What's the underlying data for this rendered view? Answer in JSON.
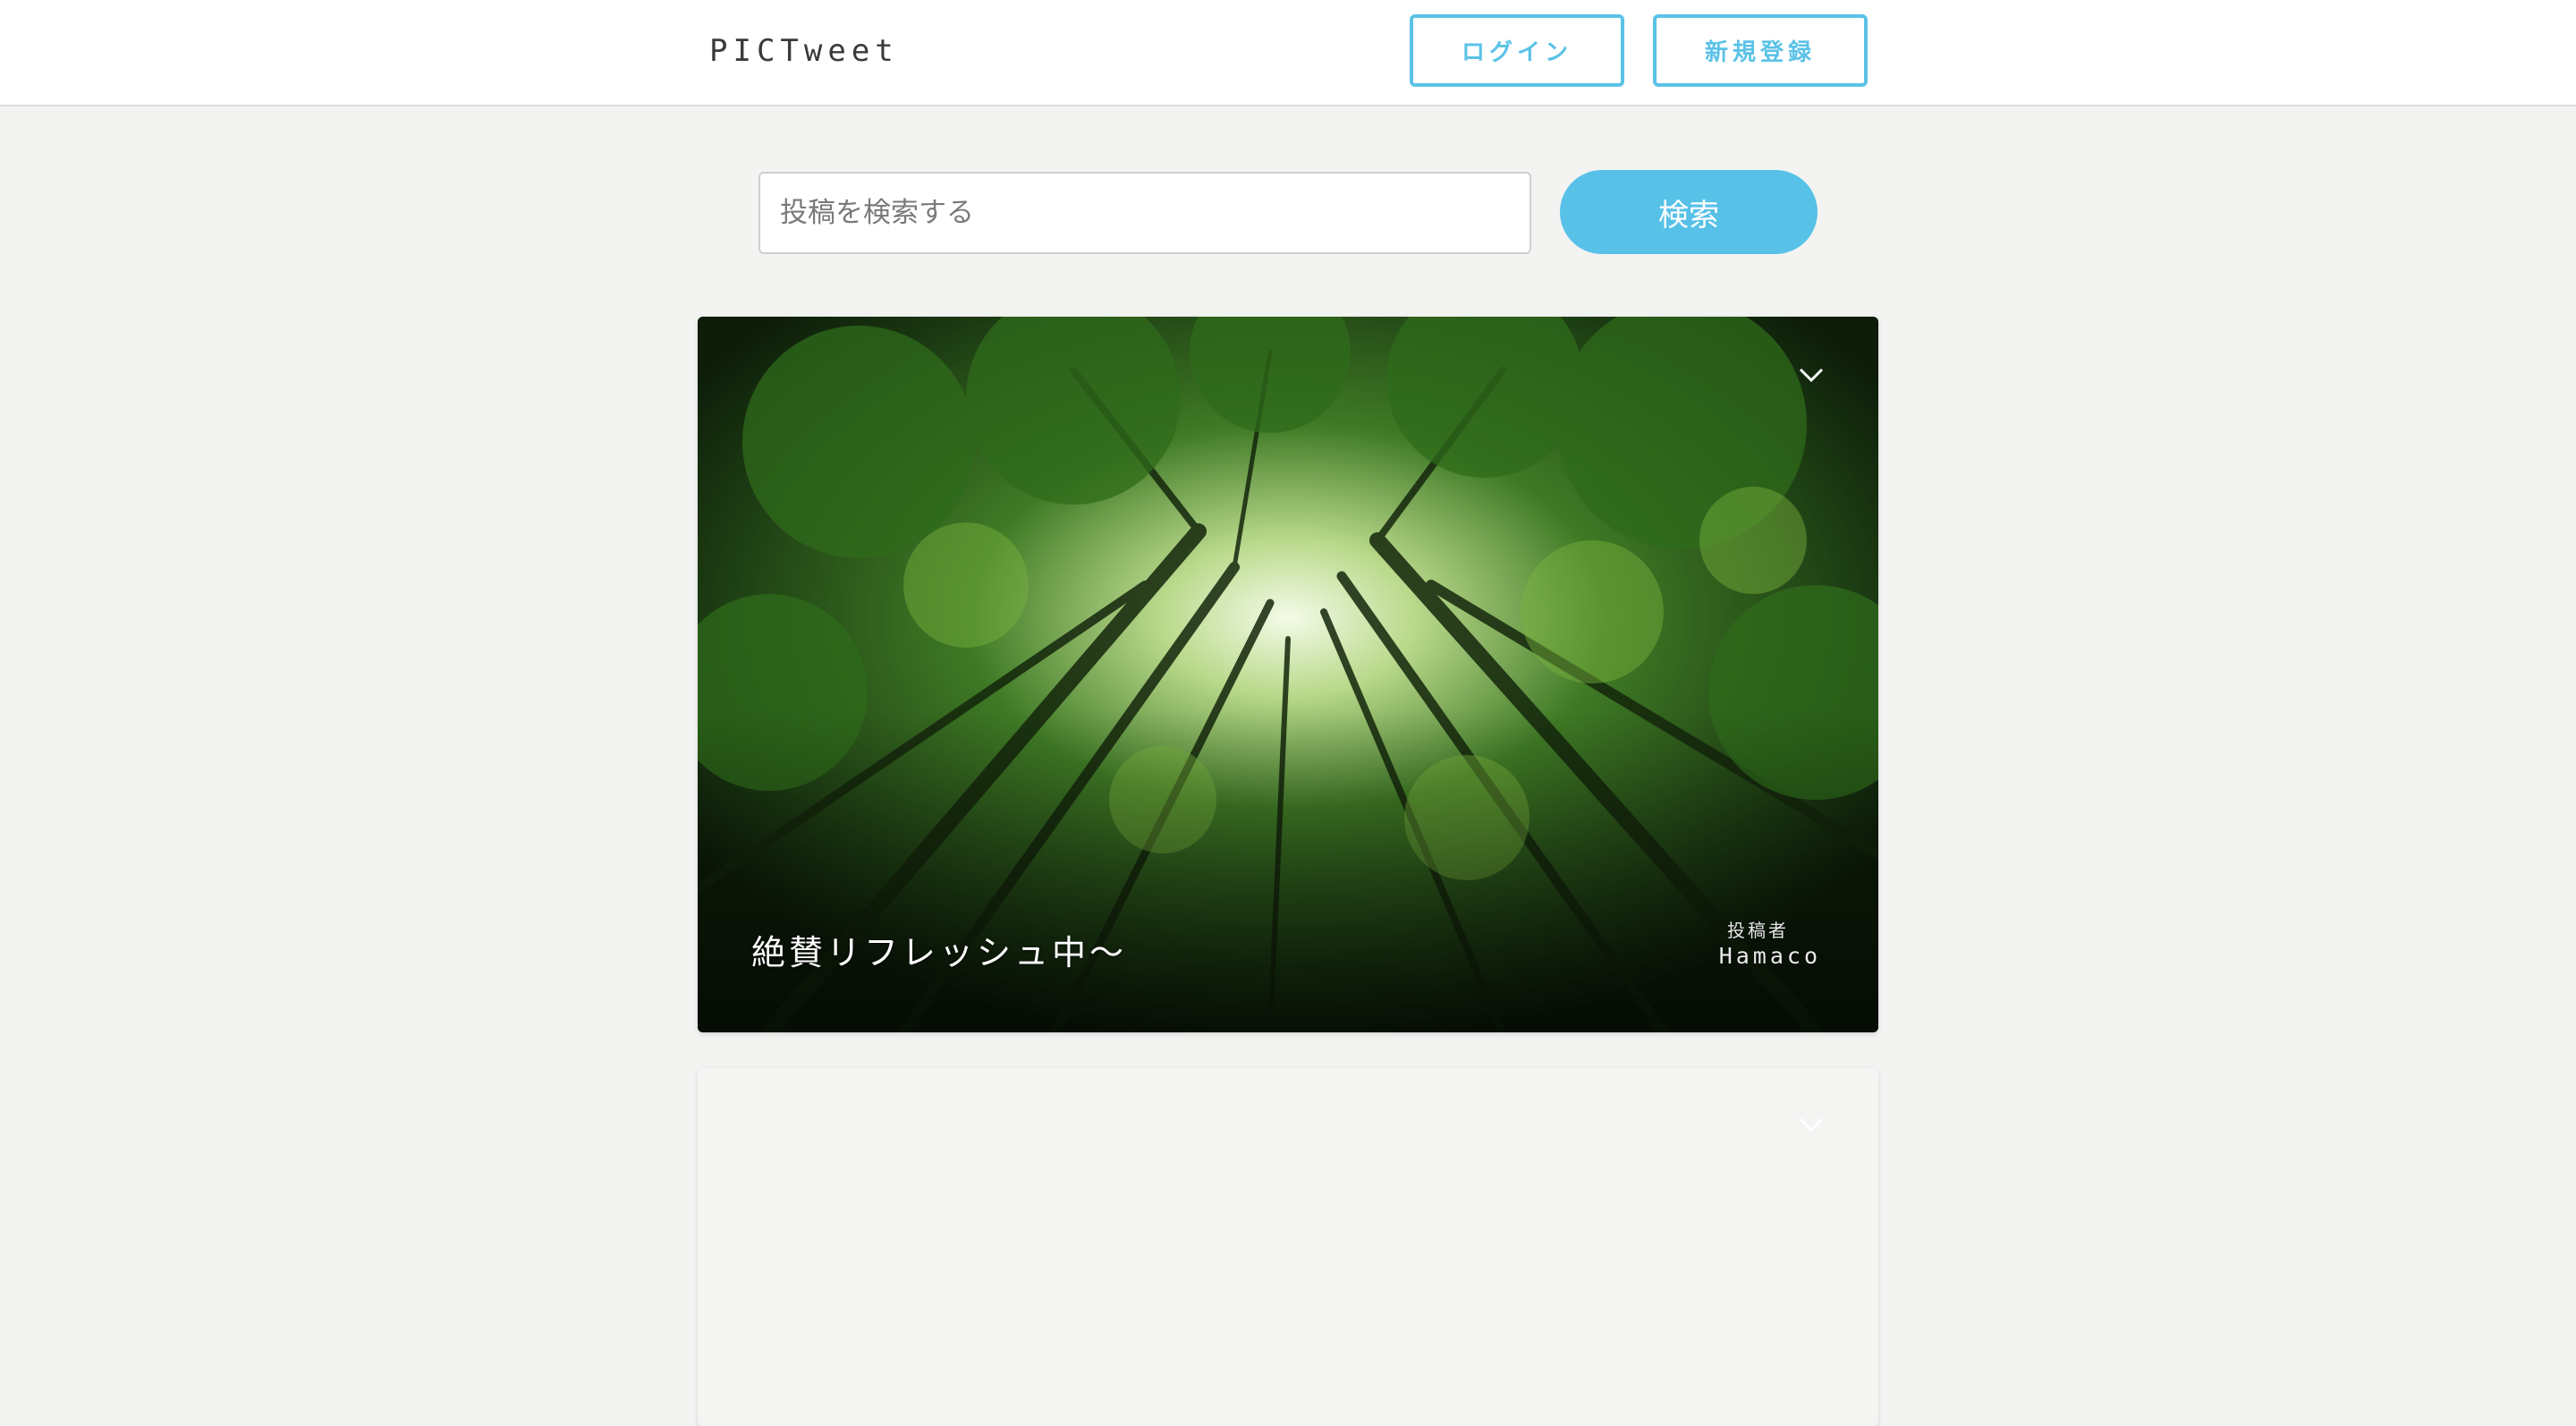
{
  "header": {
    "logo": "PICTweet",
    "login_label": "ログイン",
    "signup_label": "新規登録"
  },
  "search": {
    "placeholder": "投稿を検索する",
    "button_label": "検索"
  },
  "posts": [
    {
      "text": "絶賛リフレッシュ中〜",
      "author_label": "投稿者",
      "author_name": "Hamaco",
      "menu_icon": "chevron-down-icon"
    },
    {
      "text": "",
      "menu_icon": "chevron-down-icon"
    }
  ],
  "colors": {
    "accent": "#5bc2e7",
    "background": "#f3f3f2"
  }
}
